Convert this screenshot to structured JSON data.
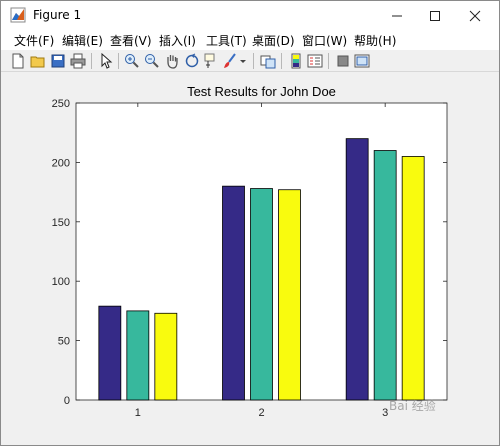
{
  "window": {
    "title": "Figure 1",
    "controls": {
      "minimize": "—",
      "maximize": "☐",
      "close": "✕"
    }
  },
  "menubar": {
    "items": [
      {
        "label": "文件(F)"
      },
      {
        "label": "编辑(E)"
      },
      {
        "label": "查看(V)"
      },
      {
        "label": "插入(I)"
      },
      {
        "label": "工具(T)"
      },
      {
        "label": "桌面(D)"
      },
      {
        "label": "窗口(W)"
      },
      {
        "label": "帮助(H)"
      }
    ]
  },
  "toolbar": {
    "buttons": [
      "new-figure-icon",
      "open-file-icon",
      "save-icon",
      "print-icon",
      "select-arrow-icon",
      "zoom-in-icon",
      "zoom-out-icon",
      "pan-hand-icon",
      "rotate-3d-icon",
      "data-cursor-icon",
      "brush-icon",
      "link-plot-icon",
      "colorbar-icon",
      "legend-icon",
      "hide-plot-tools-icon",
      "show-plot-tools-icon"
    ]
  },
  "chart_data": {
    "type": "bar",
    "title": "Test Results for John Doe",
    "xlabel": "",
    "ylabel": "",
    "categories": [
      "1",
      "2",
      "3"
    ],
    "series": [
      {
        "values": [
          79,
          180,
          220
        ],
        "color": "#352a87"
      },
      {
        "values": [
          75,
          178,
          210
        ],
        "color": "#37b89d"
      },
      {
        "values": [
          73,
          177,
          205
        ],
        "color": "#f9fb0e"
      }
    ],
    "ylim": [
      0,
      250
    ],
    "yticks": [
      0,
      50,
      100,
      150,
      200,
      250
    ],
    "grid": false
  },
  "watermark": "Bai 经验"
}
